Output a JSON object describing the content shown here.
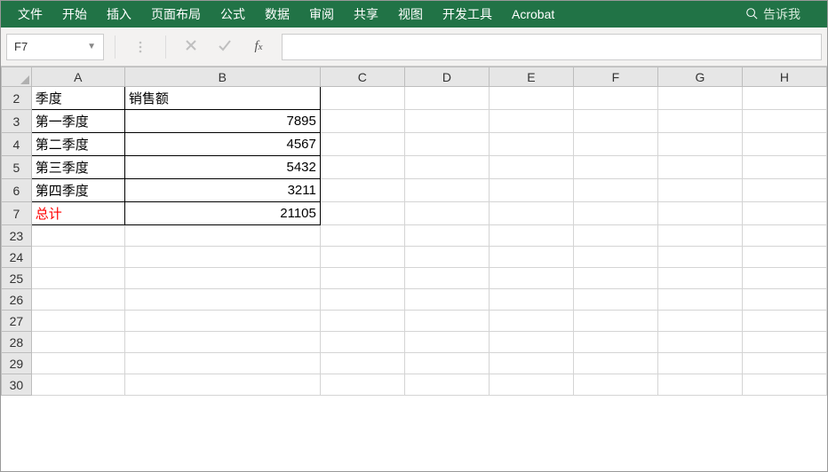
{
  "ribbon": {
    "tabs": [
      "文件",
      "开始",
      "插入",
      "页面布局",
      "公式",
      "数据",
      "审阅",
      "共享",
      "视图",
      "开发工具",
      "Acrobat"
    ],
    "search_placeholder": "告诉我"
  },
  "formula_bar": {
    "name_box": "F7",
    "formula": ""
  },
  "columns": [
    "A",
    "B",
    "C",
    "D",
    "E",
    "F",
    "G",
    "H"
  ],
  "row_headers": [
    2,
    3,
    4,
    5,
    6,
    7,
    23,
    24,
    25,
    26,
    27,
    28,
    29,
    30
  ],
  "table": {
    "header": {
      "A": "季度",
      "B": "销售额"
    },
    "rows": [
      {
        "A": "第一季度",
        "B": "7895"
      },
      {
        "A": "第二季度",
        "B": "4567"
      },
      {
        "A": "第三季度",
        "B": "5432"
      },
      {
        "A": "第四季度",
        "B": "3211"
      }
    ],
    "total": {
      "A": "总计",
      "B": "21105"
    }
  },
  "chart_data": {
    "type": "table",
    "categories": [
      "第一季度",
      "第二季度",
      "第三季度",
      "第四季度"
    ],
    "values": [
      7895,
      4567,
      5432,
      3211
    ],
    "total": 21105,
    "title": "销售额",
    "xlabel": "季度",
    "ylabel": "销售额"
  }
}
